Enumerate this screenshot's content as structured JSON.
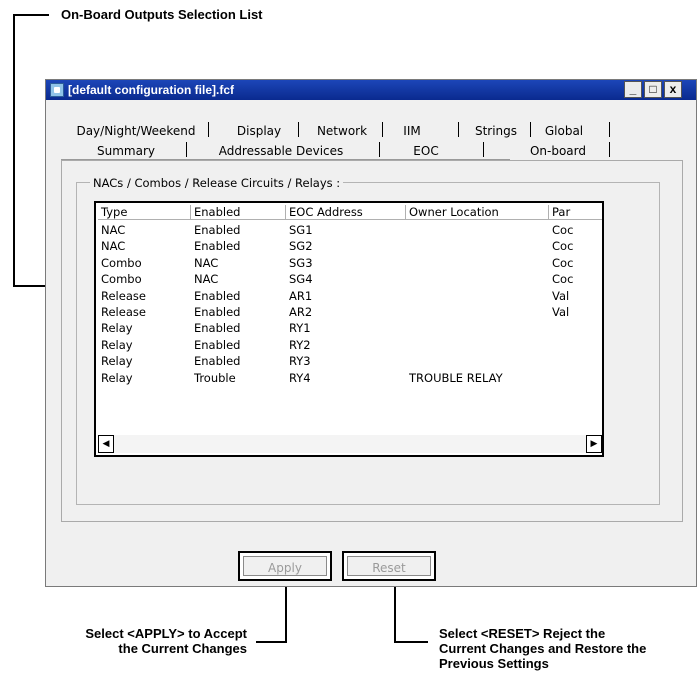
{
  "callouts": {
    "list": "On-Board Outputs Selection List",
    "apply": [
      "Select <APPLY> to Accept",
      "the Current Changes"
    ],
    "reset": [
      "Select <RESET> Reject the",
      "Current Changes and Restore the",
      "Previous Settings"
    ]
  },
  "window": {
    "title": "[default configuration file].fcf",
    "controls": {
      "minimize": "_",
      "maximize": "□",
      "close": "x"
    }
  },
  "tabs": {
    "row1": [
      "Day/Night/Weekend",
      "Display",
      "Network",
      "IIM",
      "Strings",
      "Global"
    ],
    "row2": [
      "Summary",
      "Addressable Devices",
      "EOC",
      "On-board"
    ],
    "active": "On-board"
  },
  "group_label": "NACs / Combos / Release Circuits / Relays :",
  "table": {
    "columns": [
      "Type",
      "Enabled",
      "EOC Address",
      "Owner Location",
      "Par"
    ],
    "rows": [
      [
        "NAC",
        "Enabled",
        "SG1",
        "",
        "Coc"
      ],
      [
        "NAC",
        "Enabled",
        "SG2",
        "",
        "Coc"
      ],
      [
        "Combo",
        "NAC",
        "SG3",
        "",
        "Coc"
      ],
      [
        "Combo",
        "NAC",
        "SG4",
        "",
        "Coc"
      ],
      [
        "Release",
        "Enabled",
        "AR1",
        "",
        "Val"
      ],
      [
        "Release",
        "Enabled",
        "AR2",
        "",
        "Val"
      ],
      [
        "Relay",
        "Enabled",
        "RY1",
        "",
        ""
      ],
      [
        "Relay",
        "Enabled",
        "RY2",
        "",
        ""
      ],
      [
        "Relay",
        "Enabled",
        "RY3",
        "",
        ""
      ],
      [
        "Relay",
        "Trouble",
        "RY4",
        "TROUBLE RELAY",
        ""
      ]
    ]
  },
  "buttons": {
    "apply": "Apply",
    "reset": "Reset"
  },
  "icons": {
    "scroll_left": "scroll-left-icon",
    "scroll_right": "scroll-right-icon",
    "app": "app-icon"
  }
}
